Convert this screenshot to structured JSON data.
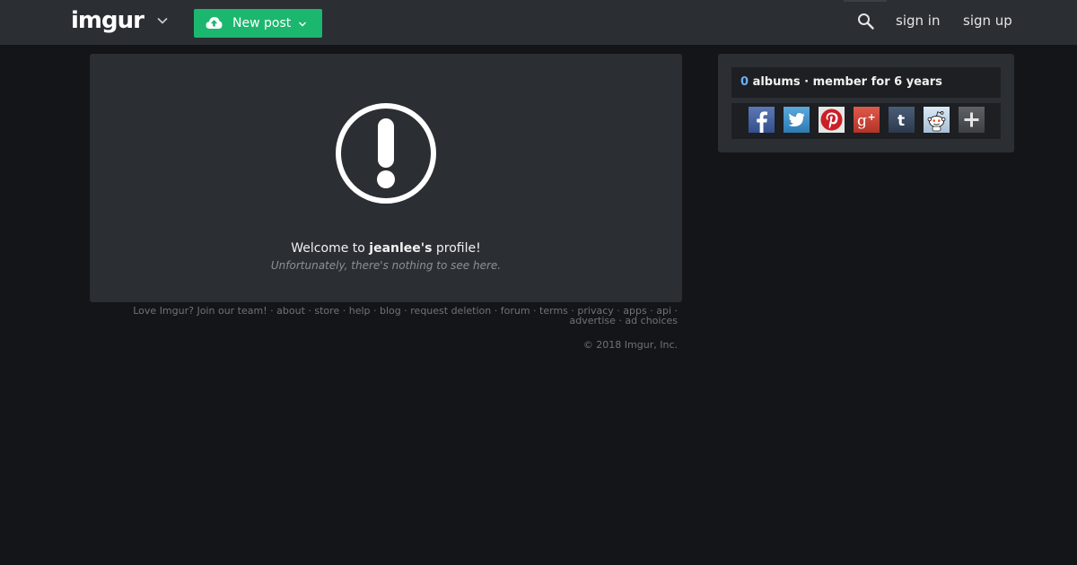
{
  "header": {
    "logo_text": "imgur",
    "new_post_label": "New post",
    "sign_in_label": "sign in",
    "sign_up_label": "sign up"
  },
  "profile": {
    "welcome_prefix": "Welcome to ",
    "username_possessive": "jeanlee's",
    "welcome_suffix": " profile!",
    "empty_message": "Unfortunately, there's nothing to see here."
  },
  "sidebar": {
    "album_count": "0",
    "albums_label": " albums · member for 6 years",
    "share_buttons": [
      {
        "name": "facebook-icon",
        "color": "#3b5998"
      },
      {
        "name": "twitter-icon",
        "color": "#3a8fc4"
      },
      {
        "name": "pinterest-icon",
        "color": "#cb2027"
      },
      {
        "name": "google-plus-icon",
        "color": "#d34836"
      },
      {
        "name": "tumblr-icon",
        "color": "#35465c"
      },
      {
        "name": "reddit-icon",
        "color": "#cee3f8"
      },
      {
        "name": "more-icon",
        "color": "#555555"
      }
    ]
  },
  "footer": {
    "links": [
      "Love Imgur? Join our team!",
      "about",
      "store",
      "help",
      "blog",
      "request deletion",
      "forum",
      "terms",
      "privacy",
      "apps",
      "api",
      "advertise",
      "ad choices"
    ],
    "copyright": "© 2018 Imgur, Inc."
  },
  "colors": {
    "background": "#141518",
    "panel": "#2b2e33",
    "accent_green": "#1bb76e",
    "count_blue": "#6bb0f4"
  }
}
